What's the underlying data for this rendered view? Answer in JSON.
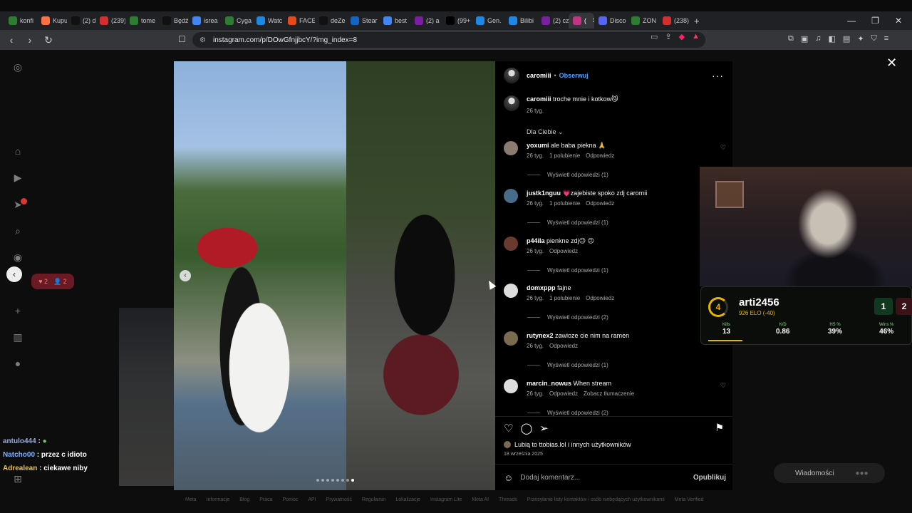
{
  "browser": {
    "tabs": [
      {
        "label": "konfi",
        "color": "#2e7d32"
      },
      {
        "label": "Kupu",
        "color": "#ff7043"
      },
      {
        "label": "(2) dw",
        "color": "#111111"
      },
      {
        "label": "(239)",
        "color": "#d32f2f"
      },
      {
        "label": "tome",
        "color": "#2e7d32"
      },
      {
        "label": "Będź",
        "color": "#111111"
      },
      {
        "label": "isrea",
        "color": "#4285f4"
      },
      {
        "label": "Cyga",
        "color": "#2e7d32"
      },
      {
        "label": "Watc",
        "color": "#1e88e5"
      },
      {
        "label": "FACE",
        "color": "#e64a19"
      },
      {
        "label": "deZe",
        "color": "#111111"
      },
      {
        "label": "Stear",
        "color": "#1565c0"
      },
      {
        "label": "best",
        "color": "#4285f4"
      },
      {
        "label": "(2) a",
        "color": "#7b1fa2"
      },
      {
        "label": "(99+",
        "color": "#000000"
      },
      {
        "label": "Gen.",
        "color": "#1e88e5"
      },
      {
        "label": "Bilibi",
        "color": "#1e88e5"
      },
      {
        "label": "(2) cz",
        "color": "#7b1fa2"
      },
      {
        "label": "(",
        "color": "#c13584",
        "active": true
      },
      {
        "label": "Disco",
        "color": "#5865f2"
      },
      {
        "label": "ZON",
        "color": "#2e7d32"
      },
      {
        "label": "(238)",
        "color": "#d32f2f"
      }
    ],
    "new_tab": "+",
    "url": "instagram.com/p/DOwGfnjjbcY/?img_index=8"
  },
  "post": {
    "author": "caromiii",
    "follow": "Obserwuj",
    "caption": "troche mnie i kotkow😼",
    "caption_age": "26 tyg.",
    "filter": "Dla Ciebie",
    "comments": [
      {
        "user": "yoxumi",
        "text": "ale baba piekna 🙏",
        "age": "26 tyg.",
        "likes": "1 polubienie",
        "reply": "Odpowiedz",
        "extra": "",
        "replies": "Wyświetl odpowiedzi (1)"
      },
      {
        "user": "justk1nguu",
        "text": "💗zajebiste spoko zdj caromii",
        "age": "26 tyg.",
        "likes": "1 polubienie",
        "reply": "Odpowiedz",
        "extra": "",
        "replies": "Wyświetl odpowiedzi (1)"
      },
      {
        "user": "p44ila",
        "text": "pienkne zdj😉 😉",
        "age": "26 tyg.",
        "likes": "",
        "reply": "Odpowiedz",
        "extra": "",
        "replies": "Wyświetl odpowiedzi (1)"
      },
      {
        "user": "domxppp",
        "text": "fajne",
        "age": "26 tyg.",
        "likes": "1 polubienie",
        "reply": "Odpowiedz",
        "extra": "",
        "replies": "Wyświetl odpowiedzi (2)"
      },
      {
        "user": "rutynex2",
        "text": "zawioze cie nim na ramen",
        "age": "26 tyg.",
        "likes": "",
        "reply": "Odpowiedz",
        "extra": "",
        "replies": "Wyświetl odpowiedzi (1)"
      },
      {
        "user": "marcin_nowus",
        "text": "When stream",
        "age": "26 tyg.",
        "likes": "",
        "reply": "Odpowiedz",
        "extra": "Zobacz tłumaczenie",
        "replies": "Wyświetl odpowiedzi (2)"
      }
    ],
    "likes_text": "Lubią to ttobias.lol i innych użytkowników",
    "date": "18 września 2025",
    "comment_placeholder": "Dodaj komentarz...",
    "post_button": "Opublikuj"
  },
  "notif_pill": {
    "likes": "2",
    "follows": "2"
  },
  "stream_overlay": {
    "level": "4",
    "player": "arti2456",
    "elo": "926 ELO (-40)",
    "badge_a": "1",
    "badge_b": "2",
    "stats": [
      {
        "label": "Kills",
        "value": "13"
      },
      {
        "label": "K/D",
        "value": "0.86"
      },
      {
        "label": "HS %",
        "value": "39%"
      },
      {
        "label": "Wins %",
        "value": "46%"
      }
    ]
  },
  "chat": [
    {
      "user": "antulo444",
      "msg": ""
    },
    {
      "user": "Natcho00",
      "msg": "przez c idioto"
    },
    {
      "user": "Adrealean",
      "msg": "ciekawe niby"
    }
  ],
  "messages_pill": "Wiadomości",
  "footer": [
    "Meta",
    "Informacje",
    "Blog",
    "Praca",
    "Pomoc",
    "API",
    "Prywatność",
    "Regulamin",
    "Lokalizacje",
    "Instagram Lite",
    "Meta AI",
    "Threads",
    "Przesyłanie listy kontaktów i osób niebędących użytkownikami",
    "Meta Verified"
  ]
}
